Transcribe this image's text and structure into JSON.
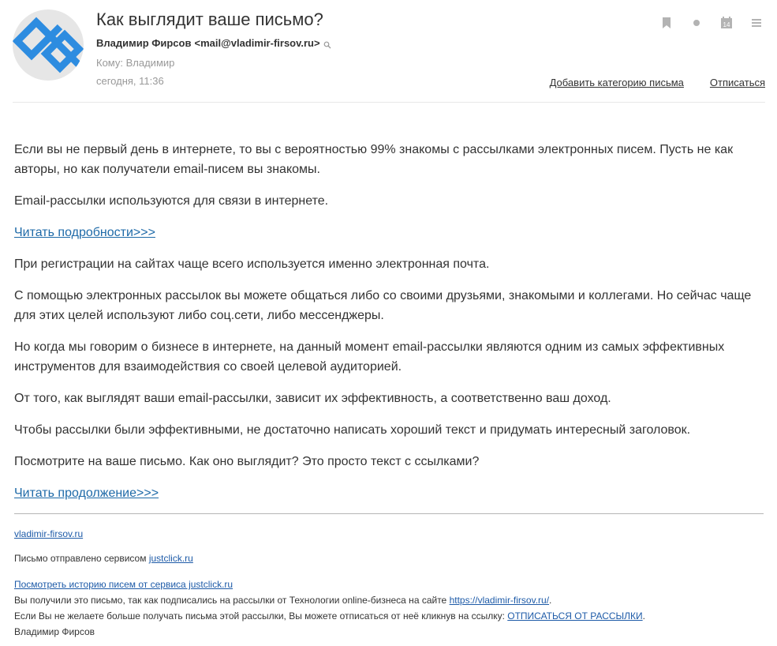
{
  "header": {
    "subject": "Как выглядит ваше письмо?",
    "from_name": "Владимир Фирсов",
    "from_email": "<mail@vladimir-firsov.ru>",
    "to_label": "Кому: Владимир",
    "date": "сегодня, 11:36",
    "add_category_link": "Добавить категорию письма",
    "unsubscribe_link": "Отписаться",
    "calendar_day": "14",
    "icons": [
      "bookmark-icon",
      "dot-icon",
      "calendar-icon",
      "menu-icon"
    ],
    "accent_color": "#2d8ce0"
  },
  "body": {
    "paragraphs": [
      "Если вы не первый день в интернете, то вы с вероятностью 99% знакомы с рассылками электронных писем. Пусть не как авторы, но как получатели email-писем вы знакомы.",
      "Email-рассылки используются для связи в интернете.",
      "При регистрации на сайтах чаще всего используется именно электронная почта.",
      "С помощью электронных рассылок вы можете общаться либо со своими друзьями, знакомыми и коллегами. Но сейчас чаще для этих целей используют либо соц.сети, либо мессенджеры.",
      "Но когда мы говорим о бизнесе в интернете, на данный момент email-рассылки являются одним из самых эффективных инструментов для взаимодействия со своей целевой аудиторией.",
      "От того, как выглядят ваши email-рассылки, зависит их эффективность, а соответственно ваш доход.",
      "Чтобы рассылки были эффективными, не достаточно написать хороший текст и придумать интересный заголовок.",
      "Посмотрите на ваше письмо. Как оно выглядит? Это просто текст с ссылками?"
    ],
    "read_more_link": "Читать подробности>>>",
    "read_continue_link": "Читать продолжение>>>",
    "link_color": "#1e6aa8"
  },
  "footer": {
    "site_link": "vladimir-firsov.ru",
    "sent_by_text": "Письмо отправлено сервисом ",
    "sent_by_link": "justclick.ru",
    "history_link": "Посмотреть историю писем от сервиса justclick.ru",
    "reason_text": "Вы получили это письмо, так как подписались на рассылки от Технологии online-бизнеса на сайте ",
    "reason_link": "https://vladimir-firsov.ru/",
    "reason_end": ".",
    "unsub_text": "Если Вы не желаете больше получать письма этой рассылки, Вы можете отписаться от неё кликнув на ссылку: ",
    "unsub_link": "ОТПИСАТЬСЯ ОТ РАССЫЛКИ",
    "unsub_end": ".",
    "signature": "Владимир Фирсов"
  }
}
